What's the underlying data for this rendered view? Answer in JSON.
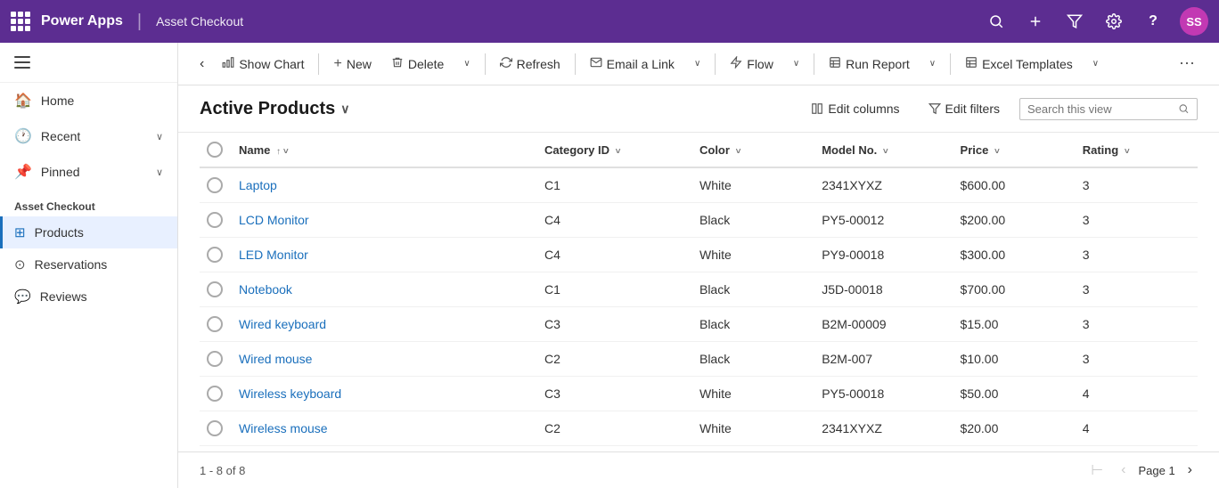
{
  "topNav": {
    "appTitle": "Power Apps",
    "separator": "|",
    "pageName": "Asset Checkout",
    "avatarText": "SS"
  },
  "sidebar": {
    "navItems": [
      {
        "label": "Home",
        "icon": "🏠"
      },
      {
        "label": "Recent",
        "icon": "🕐",
        "hasChevron": true
      },
      {
        "label": "Pinned",
        "icon": "📌",
        "hasChevron": true
      }
    ],
    "sectionLabel": "Asset Checkout",
    "appItems": [
      {
        "label": "Products",
        "icon": "⊞",
        "active": true
      },
      {
        "label": "Reservations",
        "icon": "⊙"
      },
      {
        "label": "Reviews",
        "icon": "💬"
      }
    ]
  },
  "commandBar": {
    "backBtn": "‹",
    "showChart": "Show Chart",
    "new": "New",
    "delete": "Delete",
    "refresh": "Refresh",
    "emailLink": "Email a Link",
    "flow": "Flow",
    "runReport": "Run Report",
    "excelTemplates": "Excel Templates"
  },
  "viewHeader": {
    "title": "Active Products",
    "editColumnsLabel": "Edit columns",
    "editFiltersLabel": "Edit filters",
    "searchPlaceholder": "Search this view"
  },
  "table": {
    "columns": [
      {
        "key": "name",
        "label": "Name",
        "sortIndicator": "↑ ˅"
      },
      {
        "key": "categoryId",
        "label": "Category ID",
        "sortIndicator": "˅"
      },
      {
        "key": "color",
        "label": "Color",
        "sortIndicator": "˅"
      },
      {
        "key": "modelNo",
        "label": "Model No.",
        "sortIndicator": "˅"
      },
      {
        "key": "price",
        "label": "Price",
        "sortIndicator": "˅"
      },
      {
        "key": "rating",
        "label": "Rating",
        "sortIndicator": "˅"
      }
    ],
    "rows": [
      {
        "name": "Laptop",
        "categoryId": "C1",
        "color": "White",
        "modelNo": "2341XYXZ",
        "price": "$600.00",
        "rating": "3"
      },
      {
        "name": "LCD Monitor",
        "categoryId": "C4",
        "color": "Black",
        "modelNo": "PY5-00012",
        "price": "$200.00",
        "rating": "3"
      },
      {
        "name": "LED Monitor",
        "categoryId": "C4",
        "color": "White",
        "modelNo": "PY9-00018",
        "price": "$300.00",
        "rating": "3"
      },
      {
        "name": "Notebook",
        "categoryId": "C1",
        "color": "Black",
        "modelNo": "J5D-00018",
        "price": "$700.00",
        "rating": "3"
      },
      {
        "name": "Wired keyboard",
        "categoryId": "C3",
        "color": "Black",
        "modelNo": "B2M-00009",
        "price": "$15.00",
        "rating": "3"
      },
      {
        "name": "Wired mouse",
        "categoryId": "C2",
        "color": "Black",
        "modelNo": "B2M-007",
        "price": "$10.00",
        "rating": "3"
      },
      {
        "name": "Wireless keyboard",
        "categoryId": "C3",
        "color": "White",
        "modelNo": "PY5-00018",
        "price": "$50.00",
        "rating": "4"
      },
      {
        "name": "Wireless mouse",
        "categoryId": "C2",
        "color": "White",
        "modelNo": "2341XYXZ",
        "price": "$20.00",
        "rating": "4"
      }
    ]
  },
  "footer": {
    "recordCount": "1 - 8 of 8",
    "pageLabel": "Page 1"
  }
}
